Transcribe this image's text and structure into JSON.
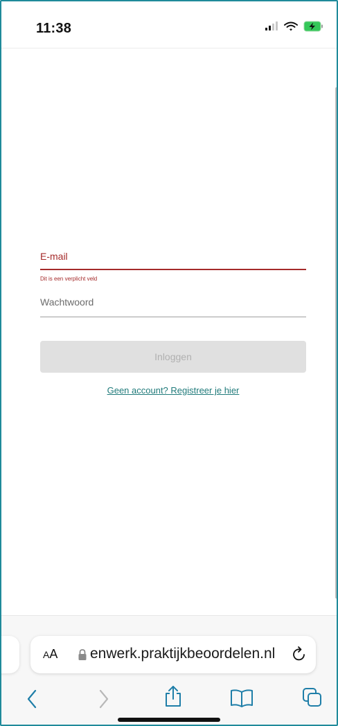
{
  "status_bar": {
    "time": "11:38",
    "icons": [
      "signal-icon",
      "wifi-icon",
      "battery-charging-icon"
    ]
  },
  "login_form": {
    "email_label": "E-mail",
    "email_error": "Dit is een verplicht veld",
    "password_label": "Wachtwoord",
    "login_button": "Inloggen",
    "register_link": "Geen account? Registreer je hier"
  },
  "browser": {
    "text_size_label_small": "A",
    "text_size_label_large": "A",
    "url": "enwerk.praktijkbeoordelen.nl",
    "toolbar": [
      "back-icon",
      "forward-icon",
      "share-icon",
      "bookmarks-icon",
      "tabs-icon"
    ]
  },
  "colors": {
    "error": "#a52a2a",
    "link": "#1f7a7a",
    "frame": "#1f8a9a"
  }
}
